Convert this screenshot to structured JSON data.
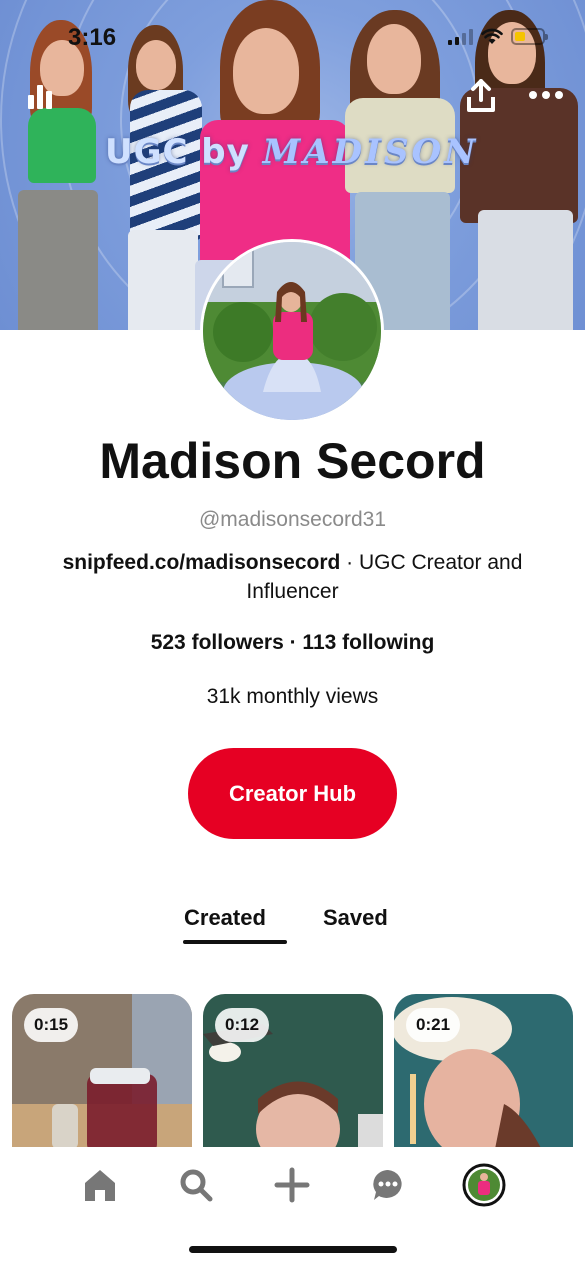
{
  "status_bar": {
    "time": "3:16"
  },
  "cover": {
    "title_prefix": "UGC by",
    "title_script": "MADISON"
  },
  "profile": {
    "name": "Madison Secord",
    "handle": "@madisonsecord31",
    "bio_link": "snipfeed.co/madisonsecord",
    "bio_text": " · UGC Creator and Influencer",
    "followers_following": "523 followers · 113 following",
    "monthly_views": "31k monthly views",
    "creator_hub_label": "Creator Hub"
  },
  "tabs": [
    {
      "label": "Created",
      "active": true
    },
    {
      "label": "Saved",
      "active": false
    }
  ],
  "pins": [
    {
      "duration": "0:15"
    },
    {
      "duration": "0:12"
    },
    {
      "duration": "0:21"
    }
  ],
  "bottom_nav": {
    "icons": [
      "home-icon",
      "search-icon",
      "plus-icon",
      "messages-icon",
      "profile-avatar"
    ]
  },
  "colors": {
    "accent": "#e60023",
    "muted_text": "#8a8a8a",
    "cover_blue": "#7f9fdd"
  }
}
